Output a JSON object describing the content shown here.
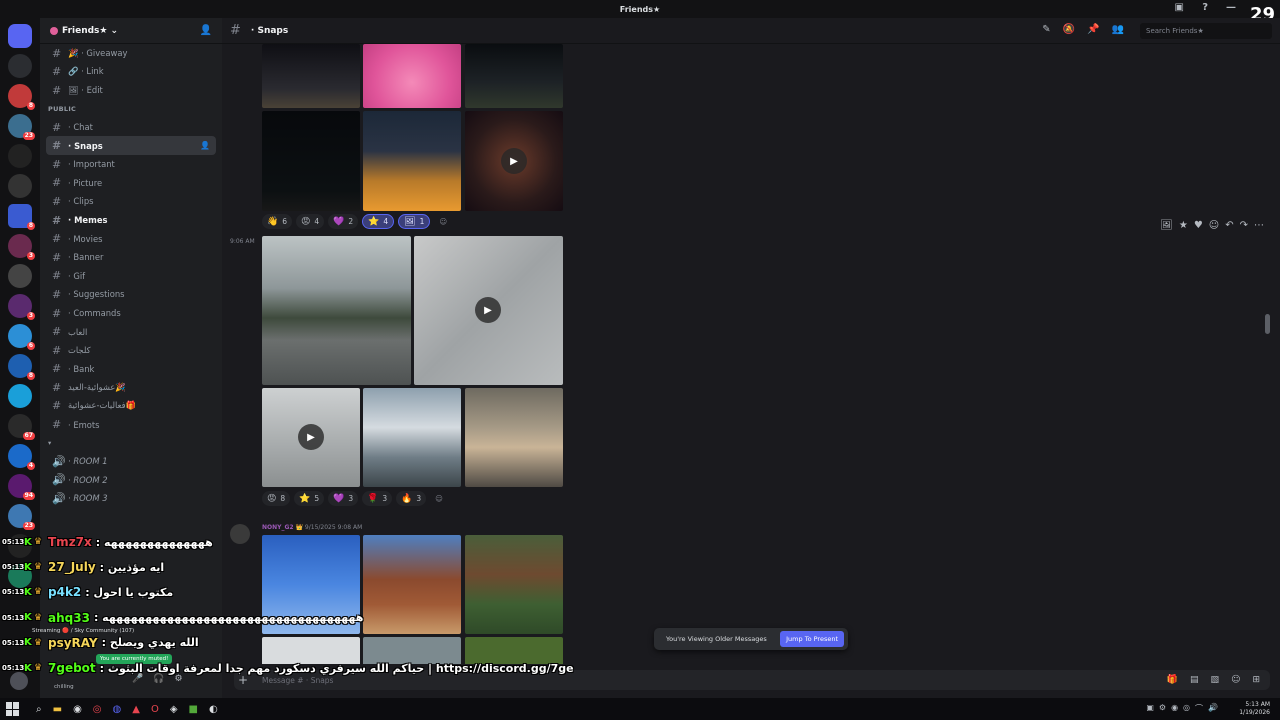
{
  "window": {
    "title": "Friends★"
  },
  "server": {
    "name": "Friends★"
  },
  "channels": [
    {
      "prefix": "#",
      "label": "🎉 · Giveaway"
    },
    {
      "prefix": "#",
      "label": "🔗 · Link"
    },
    {
      "prefix": "#",
      "label": "🖼 · Edit"
    },
    {
      "category": "PUBLIC"
    },
    {
      "prefix": "#",
      "label": "· Chat"
    },
    {
      "prefix": "#",
      "label": "· Snaps",
      "active": true
    },
    {
      "prefix": "#",
      "label": "· Important"
    },
    {
      "prefix": "#",
      "label": "· Picture"
    },
    {
      "prefix": "#",
      "label": "· Clips"
    },
    {
      "prefix": "#",
      "label": "· Memes",
      "bright": true
    },
    {
      "prefix": "#",
      "label": "· Movies"
    },
    {
      "prefix": "#",
      "label": "· Banner"
    },
    {
      "prefix": "#",
      "label": "· Gif"
    },
    {
      "prefix": "#",
      "label": "· Suggestions"
    },
    {
      "prefix": "#",
      "label": "· Commands"
    },
    {
      "prefix": "#",
      "label": "العاب"
    },
    {
      "prefix": "#",
      "label": "كلجات"
    },
    {
      "prefix": "#",
      "label": "· Bank"
    },
    {
      "prefix": "#",
      "label": "عشوائية-العيد🎉"
    },
    {
      "prefix": "#",
      "label": "فعاليات-عشوائية🎁"
    },
    {
      "prefix": "#",
      "label": "· Emots"
    },
    {
      "category": "▾"
    },
    {
      "prefix": "🔊",
      "label": "· ROOM 1",
      "voice": true
    },
    {
      "prefix": "🔊",
      "label": "· ROOM 2",
      "voice": true
    },
    {
      "prefix": "🔊",
      "label": "· ROOM 3",
      "voice": true
    }
  ],
  "header": {
    "channel": "· Snaps",
    "search_placeholder": "Search Friends★"
  },
  "messages": {
    "reactions1": [
      {
        "emoji": "👋",
        "count": "6"
      },
      {
        "emoji": "😡",
        "count": "4"
      },
      {
        "emoji": "💜",
        "count": "2"
      },
      {
        "emoji": "⭐",
        "count": "4",
        "me": true
      },
      {
        "emoji": "🖼",
        "count": "1",
        "me": true
      }
    ],
    "timestamp2": "9:06 AM",
    "reactions2": [
      {
        "emoji": "😡",
        "count": "8"
      },
      {
        "emoji": "⭐",
        "count": "5"
      },
      {
        "emoji": "💜",
        "count": "3"
      },
      {
        "emoji": "🌹",
        "count": "3"
      },
      {
        "emoji": "🔥",
        "count": "3"
      }
    ],
    "author3": "NONY_G2",
    "author3_date": "9/15/2025 9:08 AM"
  },
  "older_bar": {
    "text": "You're Viewing Older Messages",
    "button": "Jump To Present"
  },
  "composer": {
    "placeholder": "Message # · Snaps"
  },
  "overlay_chat": [
    {
      "time": "05:13",
      "user": "Tmz7x",
      "color": "#e8454f",
      "msg": ": ههههههههههههههه"
    },
    {
      "time": "05:13",
      "user": "27_July",
      "color": "#f5d65a",
      "msg": ": ايه مؤذيين"
    },
    {
      "time": "05:13",
      "user": "p4k2",
      "color": "#79e0ff",
      "msg": ": مكتوب يا احول"
    },
    {
      "time": "05:13",
      "user": "ahq33",
      "color": "#53fc18",
      "msg": ": هههههههههههههههههههههههههههههههههههه"
    },
    {
      "time": "05:13",
      "user": "psyRAY",
      "color": "#f5d65a",
      "msg": ": الله يهدي ويصلح"
    },
    {
      "time": "05:13",
      "user": "7gebot",
      "color": "#53fc18",
      "msg": ": حياكم الله سيرفري دسكورد مهم جدا لمعرفة اوقات البثوث | https://discord.gg/7ge"
    }
  ],
  "user_panel": {
    "muted": "You are currently muted!",
    "streaming": "Streaming 🔴 / Sky Community (107)",
    "status": "chilling"
  },
  "streamer_badge": "29",
  "clock": {
    "time": "5:13 AM",
    "date": "1/19/2026"
  }
}
